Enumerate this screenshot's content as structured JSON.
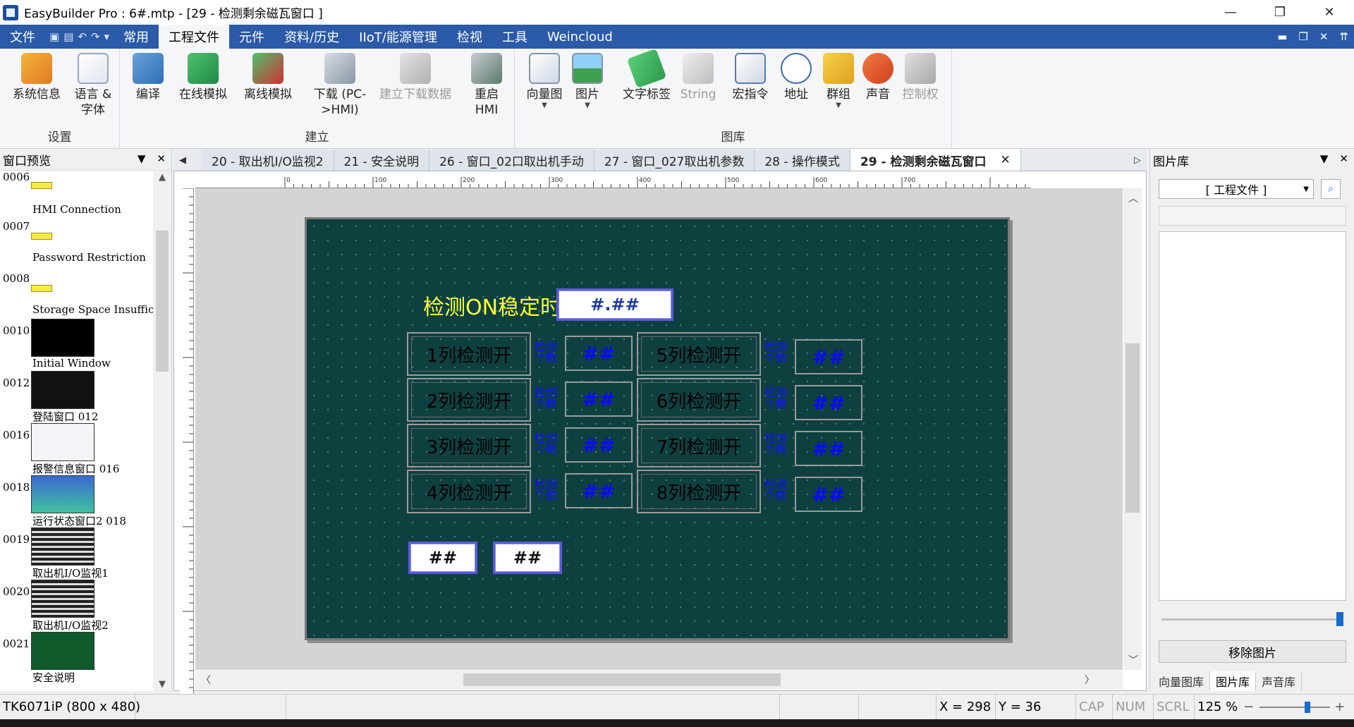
{
  "window": {
    "title": "EasyBuilder Pro : 6#.mtp - [29 - 检测剩余磁瓦窗口 ]",
    "minimize": "—",
    "maximize": "❐",
    "close": "✕"
  },
  "menubar": {
    "items": [
      "文件",
      "常用",
      "工程文件",
      "元件",
      "资料/历史",
      "IIoT/能源管理",
      "检视",
      "工具",
      "Weincloud"
    ],
    "active_index": 2,
    "quick_access": [
      "▣",
      "▤",
      "↶",
      "↷",
      "▾"
    ],
    "right_controls": [
      "▬",
      "❐",
      "✕",
      "⇈"
    ]
  },
  "ribbon": {
    "groups": [
      {
        "label": "设置",
        "buttons": [
          "系统信息",
          "语言 &\n字体"
        ]
      },
      {
        "label": "建立",
        "buttons": [
          "编译",
          "在线模拟",
          "离线模拟",
          "下载 (PC-\n>HMI)",
          "建立下载数据",
          "重启\nHMI"
        ]
      },
      {
        "label": "图库",
        "buttons": [
          "向量图",
          "图片",
          "文字标签",
          "String",
          "宏指令",
          "地址",
          "群组",
          "声音",
          "控制权"
        ]
      }
    ]
  },
  "left_panel": {
    "title": "窗口预览",
    "items": [
      {
        "num": "0006",
        "name": "HMI Connection"
      },
      {
        "num": "0007",
        "name": "Password Restriction"
      },
      {
        "num": "0008",
        "name": "Storage Space Insufficient"
      },
      {
        "num": "0010",
        "name": "Initial Window"
      },
      {
        "num": "0012",
        "name": "登陆窗口  012"
      },
      {
        "num": "0016",
        "name": "报警信息窗口  016"
      },
      {
        "num": "0018",
        "name": "运行状态窗口2  018"
      },
      {
        "num": "0019",
        "name": "取出机I/O监视1"
      },
      {
        "num": "0020",
        "name": "取出机I/O监视2"
      },
      {
        "num": "0021",
        "name": "安全说明"
      }
    ]
  },
  "tabs": [
    {
      "label": "20 - 取出机I/O监视2"
    },
    {
      "label": "21 - 安全说明"
    },
    {
      "label": "26 - 窗口_02口取出机手动"
    },
    {
      "label": "27 - 窗口_027取出机参数"
    },
    {
      "label": "28 - 操作模式"
    },
    {
      "label": "29 - 检测剩余磁瓦窗口",
      "active": true
    }
  ],
  "ruler": {
    "marks": [
      "0",
      "100",
      "200",
      "300",
      "400",
      "500",
      "600",
      "700"
    ]
  },
  "hmi": {
    "title": "检测ON稳定时间",
    "time_value": "#.##",
    "left_buttons": [
      "1列检测开",
      "2列检测开",
      "3列检测开",
      "4列检测开"
    ],
    "right_buttons": [
      "5列检测开",
      "6列检测开",
      "7列检测开",
      "8列检测开"
    ],
    "count_label": "检测\n个数",
    "count_value": "##",
    "bottom_values": [
      "##",
      "##"
    ]
  },
  "right_panel": {
    "title": "图片库",
    "select_value": "[ 工程文件 ]",
    "remove_button": "移除图片",
    "tabs": [
      "向量图库",
      "图片库",
      "声音库"
    ],
    "active_tab": 1
  },
  "statusbar": {
    "model": "TK6071iP (800 x 480)",
    "x": "X = 298",
    "y": "Y = 36",
    "cap": "CAP",
    "num": "NUM",
    "scrl": "SCRL",
    "zoom": "125 %"
  }
}
